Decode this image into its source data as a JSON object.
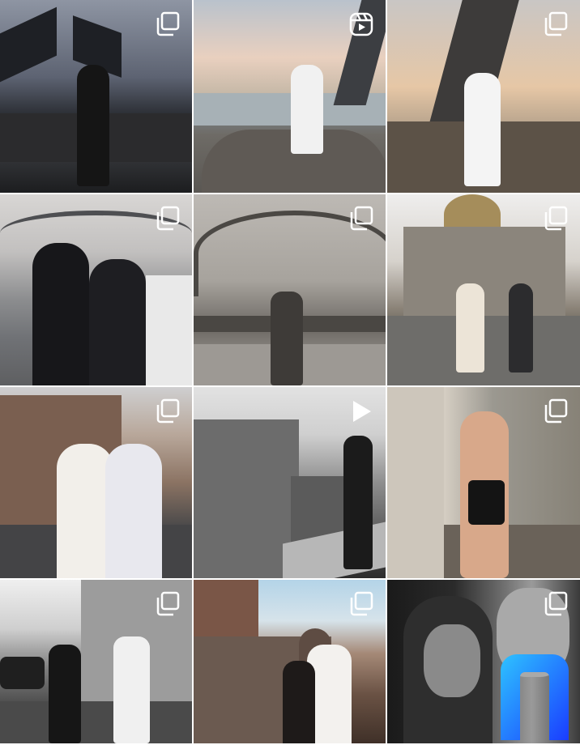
{
  "feed": {
    "tiles": [
      {
        "badge": "multiple-photos"
      },
      {
        "badge": "reels"
      },
      {
        "badge": "multiple-photos"
      },
      {
        "badge": "multiple-photos"
      },
      {
        "badge": "multiple-photos"
      },
      {
        "badge": "multiple-photos"
      },
      {
        "badge": "multiple-photos"
      },
      {
        "badge": "video-play"
      },
      {
        "badge": "multiple-photos"
      },
      {
        "badge": "multiple-photos"
      },
      {
        "badge": "multiple-photos"
      },
      {
        "badge": "multiple-photos"
      }
    ]
  },
  "colors": {
    "badge": "#ffffff",
    "logo_gradient_start": "#2ec3ff",
    "logo_gradient_end": "#1a3cff"
  }
}
